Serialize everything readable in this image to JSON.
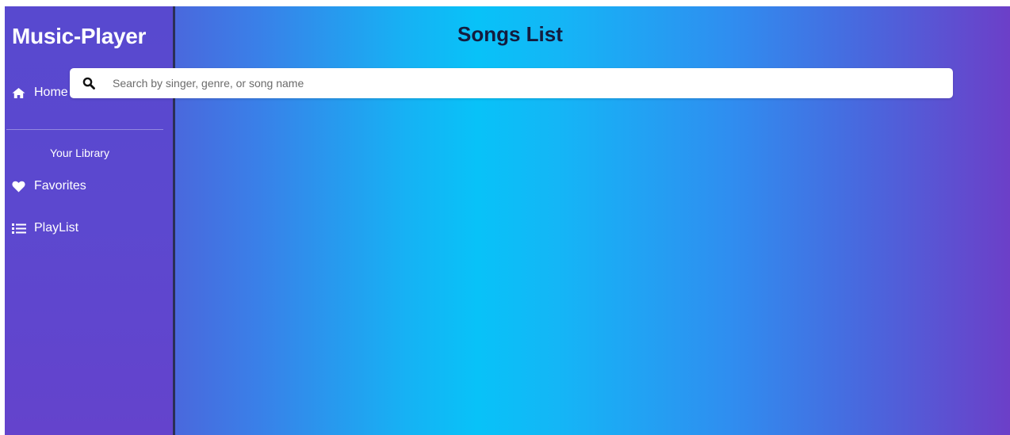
{
  "sidebar": {
    "brand": "Music-Player",
    "home_label": "Home",
    "library_heading": "Your Library",
    "items": [
      {
        "label": "Favorites",
        "icon": "heart-icon"
      },
      {
        "label": "PlayList",
        "icon": "list-icon"
      }
    ],
    "home_icon": "home-icon"
  },
  "main": {
    "title": "Songs List",
    "search": {
      "placeholder": "Search by singer, genre, or song name",
      "value": "",
      "icon": "search-icon"
    }
  },
  "colors": {
    "sidebar": "#5a48cf",
    "gradient_center": "#08c2f8",
    "gradient_edge": "#6c3fc8",
    "title_text": "#141c3e",
    "text_light": "#ffffff"
  }
}
